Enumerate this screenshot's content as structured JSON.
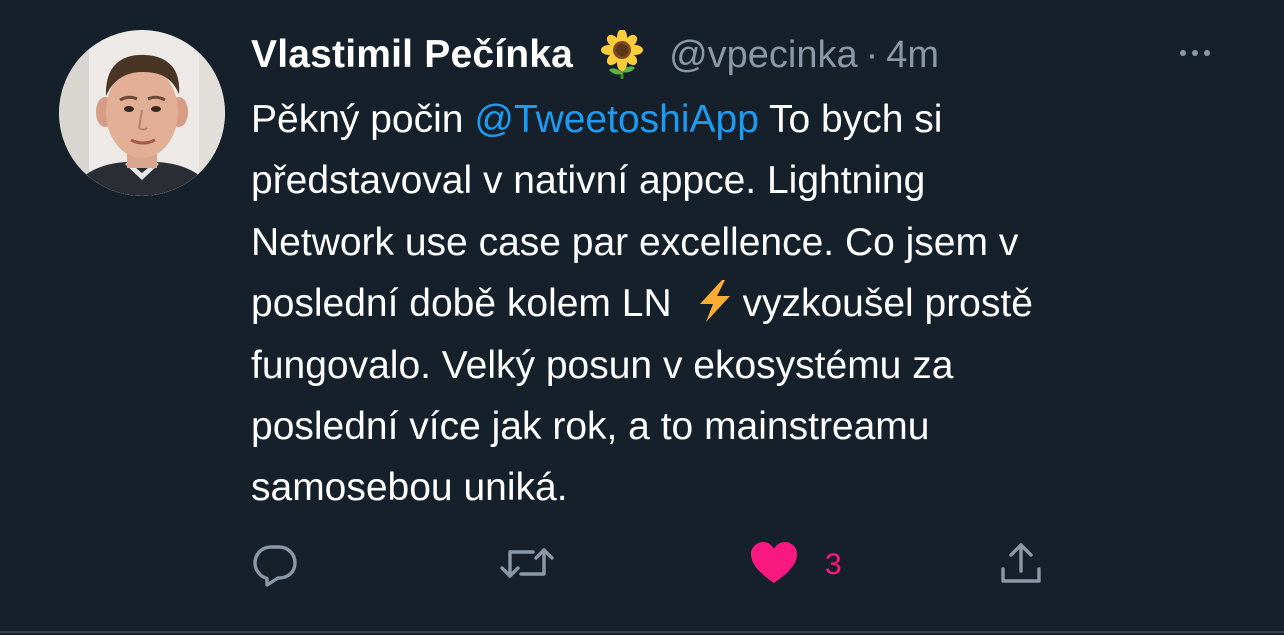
{
  "tweet": {
    "author": {
      "display_name": "Vlastimil Pečínka",
      "name_emoji": "sunflower-icon",
      "handle": "@vpecinka",
      "separator": "·",
      "time": "4m"
    },
    "body": {
      "line1_pre": "Pěkný počin ",
      "line1_mention": "@TweetoshiApp",
      "line1_post": " To bych si",
      "line2": "představoval v nativní appce. Lightning",
      "line3": "Network use case par excellence. Co jsem v",
      "line4_pre": "poslední době kolem LN ",
      "line4_emoji": "high-voltage-icon",
      "line4_post": "vyzkoušel prostě",
      "line5": "fungovalo. Velký posun v ekosystému za",
      "line6": "poslední více jak rok, a to mainstreamu",
      "line7": "samosebou uniká."
    },
    "actions": {
      "reply_icon": "reply-icon",
      "retweet_icon": "retweet-icon",
      "like_icon": "heart-icon",
      "like_count": "3",
      "share_icon": "share-icon"
    }
  },
  "colors": {
    "background": "#15202b",
    "text_primary": "#ffffff",
    "text_secondary": "#8b98a5",
    "link": "#1d9bf0",
    "like": "#f91880",
    "divider": "#38444d"
  }
}
